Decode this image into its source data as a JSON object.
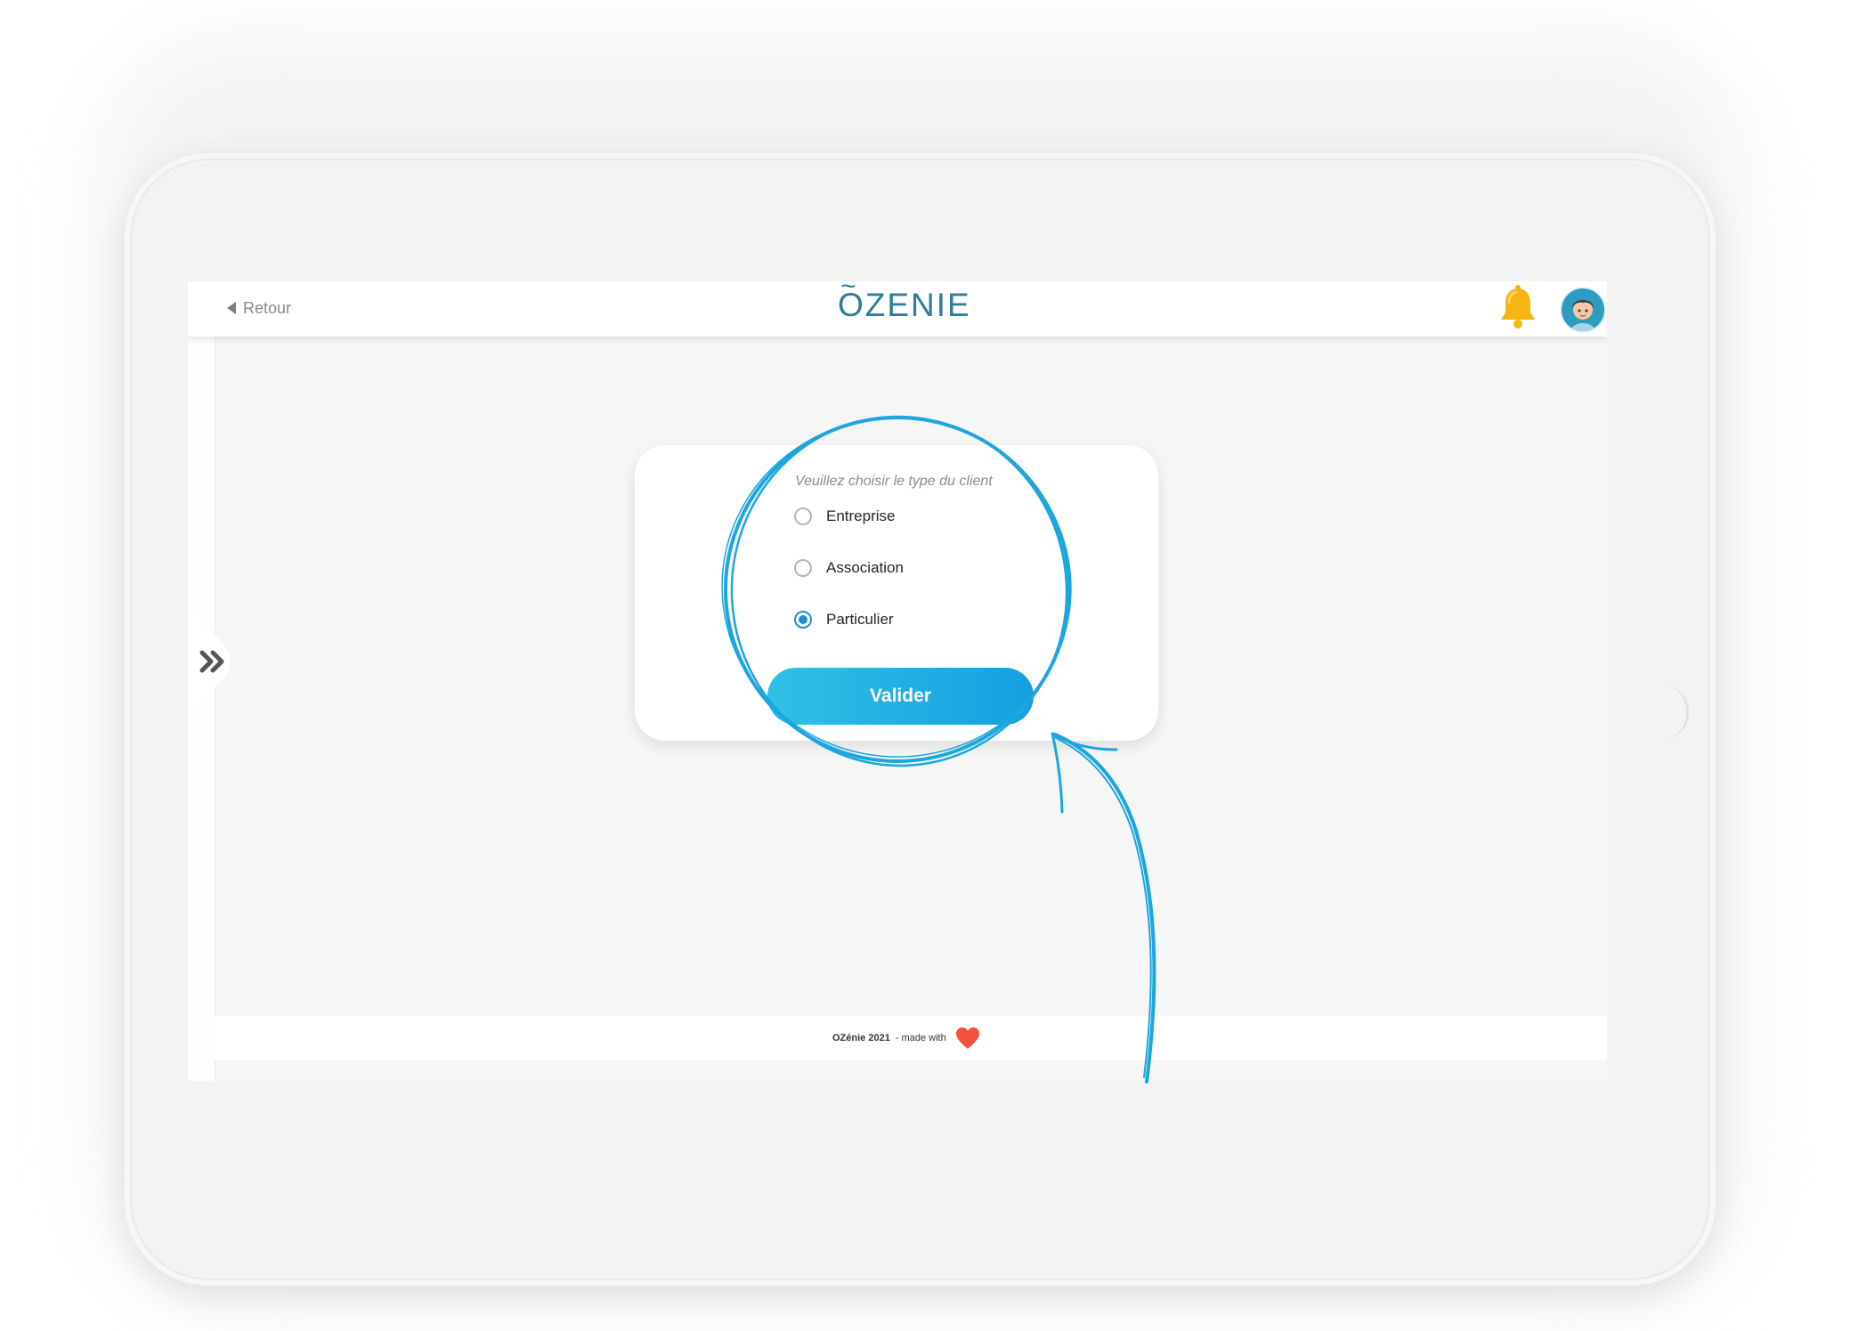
{
  "topbar": {
    "back_label": "Retour",
    "logo_text": "ZENIE",
    "logo_first_letter": "O"
  },
  "form": {
    "prompt": "Veuillez choisir le type du client",
    "options": [
      {
        "label": "Entreprise",
        "selected": false
      },
      {
        "label": "Association",
        "selected": false
      },
      {
        "label": "Particulier",
        "selected": true
      }
    ],
    "submit_label": "Valider"
  },
  "footer": {
    "brand": "OZénie 2021",
    "made_with": "- made with"
  },
  "colors": {
    "accent": "#149fe0",
    "logo": "#2d7e97",
    "bell": "#f6b511",
    "heart": "#f0523c"
  },
  "icons": {
    "back": "back-arrow-icon",
    "notification": "bell-icon",
    "profile": "avatar",
    "sidebar_toggle": "double-chevron-right-icon",
    "love": "heart-icon"
  }
}
